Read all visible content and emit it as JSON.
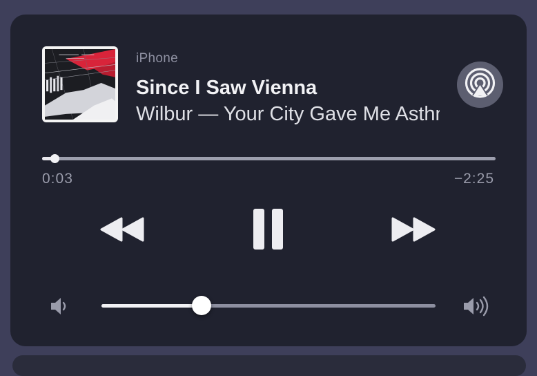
{
  "player": {
    "device": "iPhone",
    "song": "Since I Saw Vienna",
    "artist_album": "Wilbur — Your City Gave Me Asthma",
    "elapsed": "0:03",
    "remaining": "−2:25",
    "progress_fraction": 0.027,
    "volume_fraction": 0.3
  },
  "icons": {
    "airplay": "airplay-icon",
    "rewind": "rewind-icon",
    "pause": "pause-icon",
    "forward": "fast-forward-icon",
    "volume_low": "volume-low-icon",
    "volume_high": "volume-high-icon"
  },
  "colors": {
    "card_background": "#20222f",
    "page_background": "#3e3f5a",
    "accent_red": "#d8243a"
  }
}
